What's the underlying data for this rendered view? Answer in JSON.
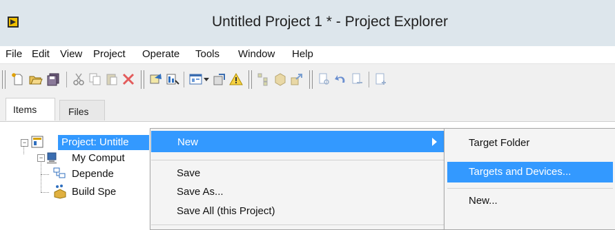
{
  "window": {
    "title": "Untitled Project 1 * - Project Explorer"
  },
  "menubar": {
    "items": [
      "File",
      "Edit",
      "View",
      "Project",
      "Operate",
      "Tools",
      "Window",
      "Help"
    ]
  },
  "toolbar": {
    "icons": [
      "new-icon",
      "open-icon",
      "save-all-icon",
      "cut-icon",
      "copy-icon",
      "paste-icon",
      "delete-icon",
      "build-icon",
      "deploy-icon",
      "view-icon",
      "dropdown-icon",
      "properties-icon",
      "warning-icon",
      "hierarchy-icon",
      "package-icon",
      "export-icon",
      "find-icon",
      "undo-icon",
      "redo-icon",
      "add-icon"
    ]
  },
  "tabs": [
    {
      "label": "Items"
    },
    {
      "label": "Files"
    }
  ],
  "tree": {
    "project": "Project: Untitle",
    "computer": "My Comput",
    "dependencies": "Depende",
    "build": "Build Spe"
  },
  "context_menu": {
    "items": [
      {
        "label": "New",
        "highlighted": true,
        "submenu": true
      },
      {
        "label": "Save"
      },
      {
        "label": "Save As..."
      },
      {
        "label": "Save All (this Project)"
      }
    ]
  },
  "submenu": {
    "items": [
      {
        "label": "Target Folder"
      },
      {
        "label": "Targets and Devices...",
        "highlighted": true
      },
      {
        "label": "New..."
      }
    ]
  },
  "colors": {
    "highlight": "#3399ff",
    "titlebar": "#dde6ec",
    "toolbar": "#f0f0f0",
    "menu_bg": "#f4f4f4"
  }
}
